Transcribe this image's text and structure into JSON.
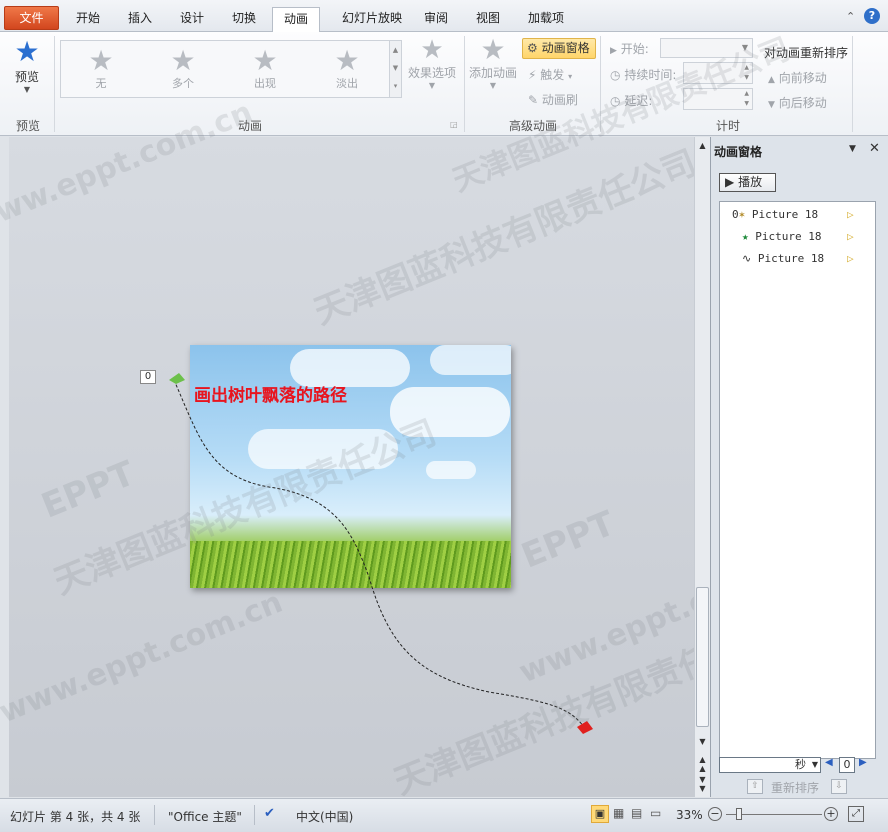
{
  "tabs": [
    "文件",
    "开始",
    "插入",
    "设计",
    "切换",
    "动画",
    "幻灯片放映",
    "审阅",
    "视图",
    "加载项"
  ],
  "help_glyph": "?",
  "ribbon": {
    "preview_label": "预览",
    "preview_group": "预览",
    "effects": [
      "无",
      "多个",
      "出现",
      "淡出"
    ],
    "effect_options": "效果选项",
    "animation_group": "动画",
    "add_animation": "添加动画",
    "anim_pane_button": "动画窗格",
    "trigger": "触发",
    "anim_painter": "动画刷",
    "advanced_group": "高级动画",
    "start_label": "开始:",
    "duration_label": "持续时间:",
    "delay_label": "延迟:",
    "timing_group": "计时",
    "reorder_title": "对动画重新排序",
    "move_earlier": "向前移动",
    "move_later": "向后移动"
  },
  "slide": {
    "title": "画出树叶飘落的路径",
    "marker": "0"
  },
  "pane": {
    "title": "动画窗格",
    "play": "播放",
    "items": [
      {
        "index": "0",
        "name": "Picture 18"
      },
      {
        "index": "",
        "name": "Picture 18"
      },
      {
        "index": "",
        "name": "Picture 18"
      }
    ],
    "unit": "秒",
    "timeline_value": "0",
    "reorder": "重新排序"
  },
  "status": {
    "slide_info": "幻灯片 第 4 张，共 4 张",
    "theme": "\"Office 主题\"",
    "language": "中文(中国)",
    "zoom": "33%"
  },
  "watermarks": [
    "天津图蓝科技有限责任公司",
    "www.eppt.com.cn",
    "EPPT"
  ],
  "colors": {
    "file_tab": "#d2461e",
    "slide_title": "#e8141e",
    "accent": "#ffd66b"
  }
}
